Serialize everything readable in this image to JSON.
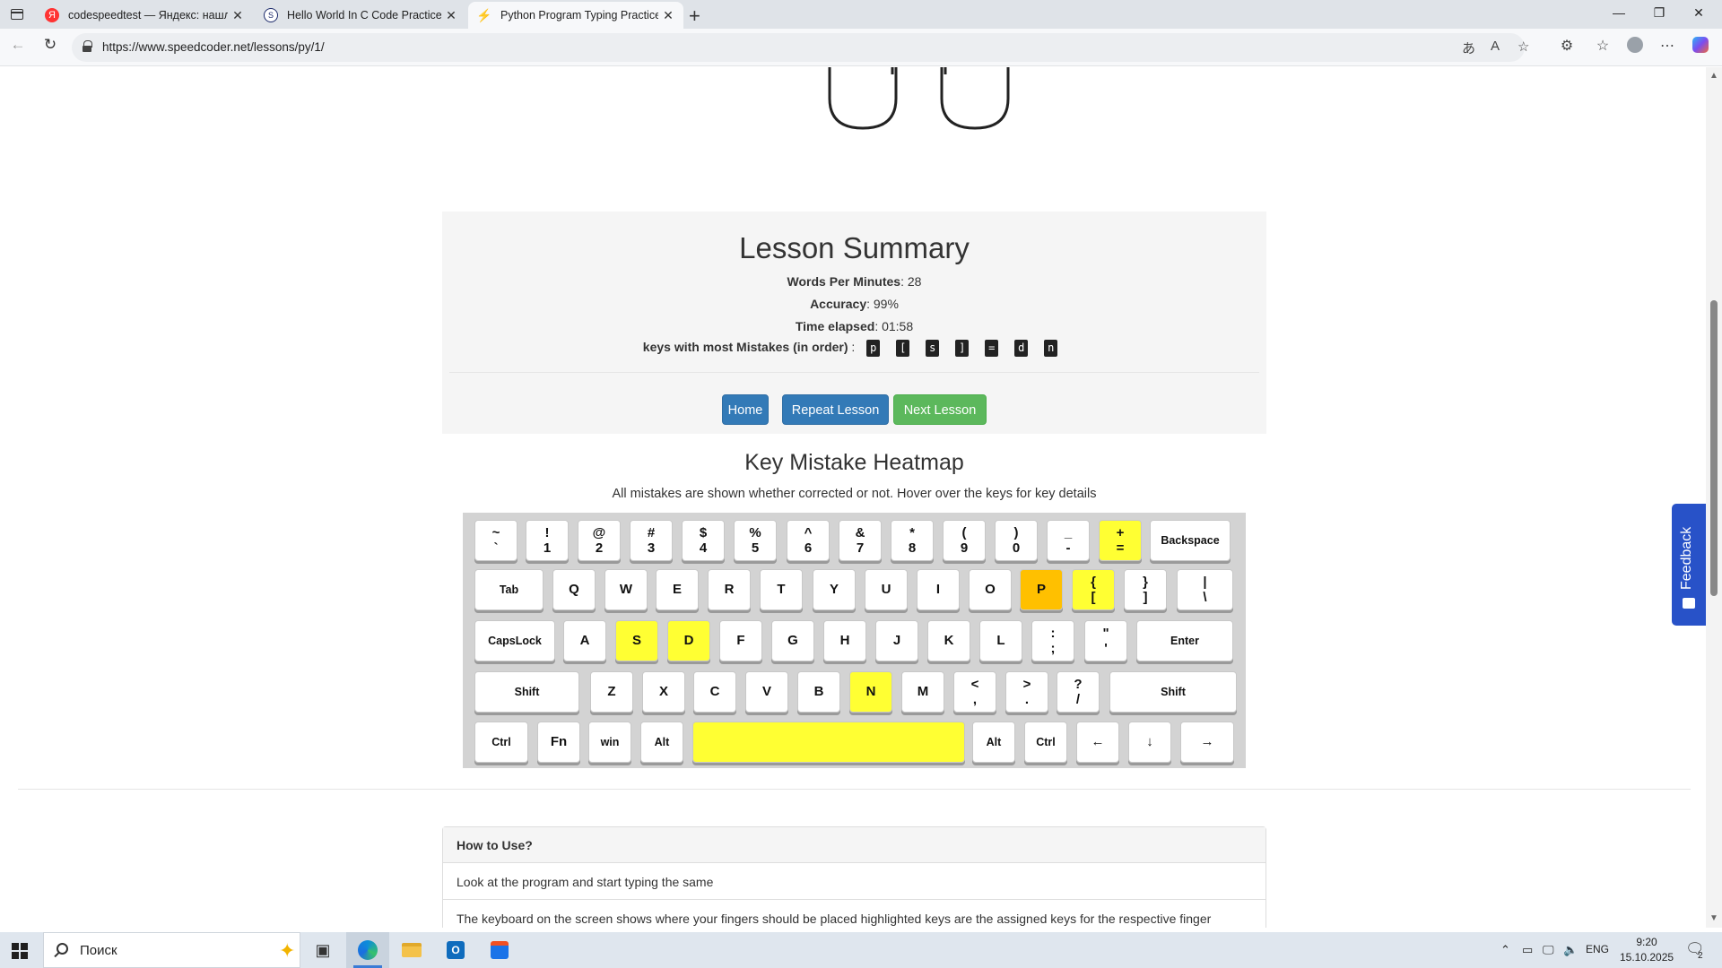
{
  "browser": {
    "tabs": [
      {
        "title": "codespeedtest — Яндекс: нашлось",
        "favicon": "yandex-icon",
        "active": false
      },
      {
        "title": "Hello World In C Code Practice in",
        "favicon": "speedcoder-icon",
        "active": false
      },
      {
        "title": "Python Program Typing Practice |",
        "favicon": "bolt-icon",
        "active": true
      }
    ],
    "url": "https://www.speedcoder.net/lessons/py/1/"
  },
  "summary": {
    "title": "Lesson Summary",
    "wpm_label": "Words Per Minutes",
    "wpm_value": ": 28",
    "accuracy_label": "Accuracy",
    "accuracy_value": ": 99%",
    "time_label": "Time elapsed",
    "time_value": ": 01:58",
    "mistakes_label": "keys with most Mistakes (in order)",
    "mistakes_sep": " : ",
    "mistake_keys": [
      "p",
      "[",
      "s",
      "]",
      "=",
      "d",
      "n"
    ],
    "buttons": {
      "home": "Home",
      "repeat": "Repeat Lesson",
      "next": "Next Lesson"
    }
  },
  "heatmap": {
    "title": "Key Mistake Heatmap",
    "subtitle": "All mistakes are shown whether corrected or not. Hover over the keys for key details",
    "rows": [
      [
        [
          "~",
          "`"
        ],
        [
          "!",
          "1"
        ],
        [
          "@",
          "2"
        ],
        [
          "#",
          "3"
        ],
        [
          "$",
          "4"
        ],
        [
          "%",
          "5"
        ],
        [
          "^",
          "6"
        ],
        [
          "&",
          "7"
        ],
        [
          "*",
          "8"
        ],
        [
          "(",
          "9"
        ],
        [
          ")",
          "0"
        ],
        [
          "_",
          "-"
        ],
        [
          "+",
          "="
        ],
        [
          "Backspace"
        ]
      ],
      [
        [
          "Tab"
        ],
        [
          "Q"
        ],
        [
          "W"
        ],
        [
          "E"
        ],
        [
          "R"
        ],
        [
          "T"
        ],
        [
          "Y"
        ],
        [
          "U"
        ],
        [
          "I"
        ],
        [
          "O"
        ],
        [
          "P"
        ],
        [
          "{",
          "["
        ],
        [
          "}",
          "]"
        ],
        [
          "|",
          "\\"
        ]
      ],
      [
        [
          "CapsLock"
        ],
        [
          "A"
        ],
        [
          "S"
        ],
        [
          "D"
        ],
        [
          "F"
        ],
        [
          "G"
        ],
        [
          "H"
        ],
        [
          "J"
        ],
        [
          "K"
        ],
        [
          "L"
        ],
        [
          ":",
          ";"
        ],
        [
          "\"",
          "'"
        ],
        [
          "Enter"
        ]
      ],
      [
        [
          "Shift"
        ],
        [
          "Z"
        ],
        [
          "X"
        ],
        [
          "C"
        ],
        [
          "V"
        ],
        [
          "B"
        ],
        [
          "N"
        ],
        [
          "M"
        ],
        [
          "<",
          ","
        ],
        [
          ">",
          "."
        ],
        [
          "?",
          "/"
        ],
        [
          "Shift"
        ]
      ],
      [
        [
          "Ctrl"
        ],
        [
          "Fn"
        ],
        [
          "win"
        ],
        [
          "Alt"
        ],
        [
          ""
        ],
        [
          "Alt"
        ],
        [
          "Ctrl"
        ],
        [
          "←"
        ],
        [
          "↓"
        ],
        [
          "→"
        ]
      ]
    ],
    "highlight": {
      "yellow": [
        "+=",
        "{[",
        "S",
        "D",
        "N",
        "space"
      ],
      "orange": [
        "P"
      ]
    },
    "colors": {
      "mistake_light": "#ffff33",
      "mistake_heavy": "#ffc000",
      "board": "#d3d3d3"
    }
  },
  "howto": {
    "title": "How to Use?",
    "items": [
      "Look at the program and start typing the same",
      "The keyboard on the screen shows where your fingers should be placed highlighted keys are the assigned keys for the respective finger"
    ]
  },
  "feedback_label": "Feedback",
  "taskbar": {
    "search_placeholder": "Поиск",
    "lang": "ENG",
    "time": "9:20",
    "date": "15.10.2025",
    "notifications": "2"
  }
}
